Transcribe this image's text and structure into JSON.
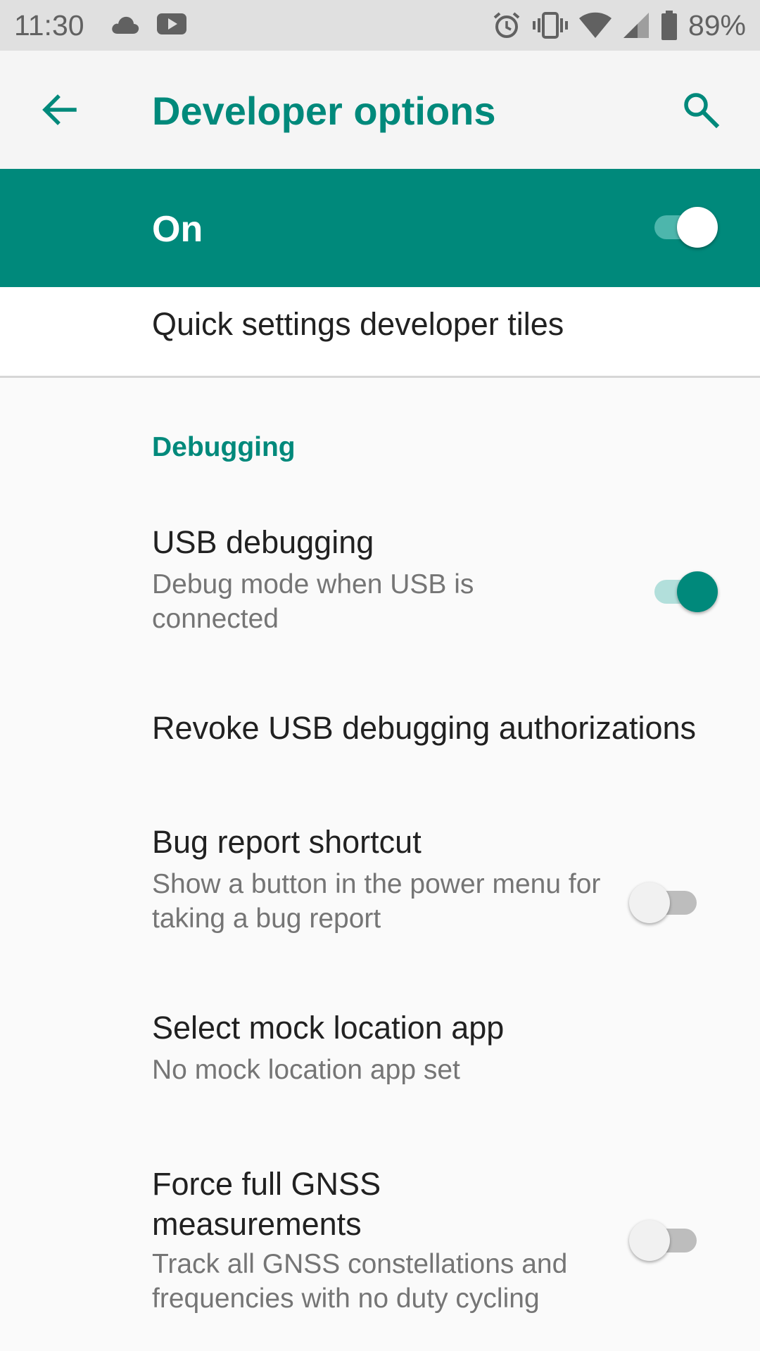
{
  "status_bar": {
    "time": "11:30",
    "battery": "89%",
    "icons_left": [
      "cloud-icon",
      "youtube-icon"
    ],
    "icons_right": [
      "alarm-icon",
      "vibrate-icon",
      "wifi-icon",
      "signal-icon",
      "battery-icon"
    ]
  },
  "app_bar": {
    "title": "Developer options",
    "back_icon": "back-arrow-icon",
    "search_icon": "search-icon"
  },
  "master": {
    "label": "On",
    "checked": true
  },
  "quick_tiles": {
    "title": "Quick settings developer tiles"
  },
  "section": {
    "header": "Debugging"
  },
  "settings": [
    {
      "title": "USB debugging",
      "summary": "Debug mode when USB is connected",
      "switch": true,
      "checked": true
    },
    {
      "title": "Revoke USB debugging authorizations",
      "summary": ""
    },
    {
      "title": "Bug report shortcut",
      "summary": "Show a button in the power menu for taking a bug report",
      "switch": true,
      "checked": false
    },
    {
      "title": "Select mock location app",
      "summary": "No mock location app set"
    },
    {
      "title": "Force full GNSS measurements",
      "summary": "Track all GNSS constellations and frequencies with no duty cycling",
      "switch": true,
      "checked": false
    }
  ],
  "colors": {
    "accent": "#00897b",
    "master_bar": "#00897b",
    "status_bar": "#e0e0e0",
    "app_bar": "#f5f5f5",
    "background": "#fafafa"
  }
}
